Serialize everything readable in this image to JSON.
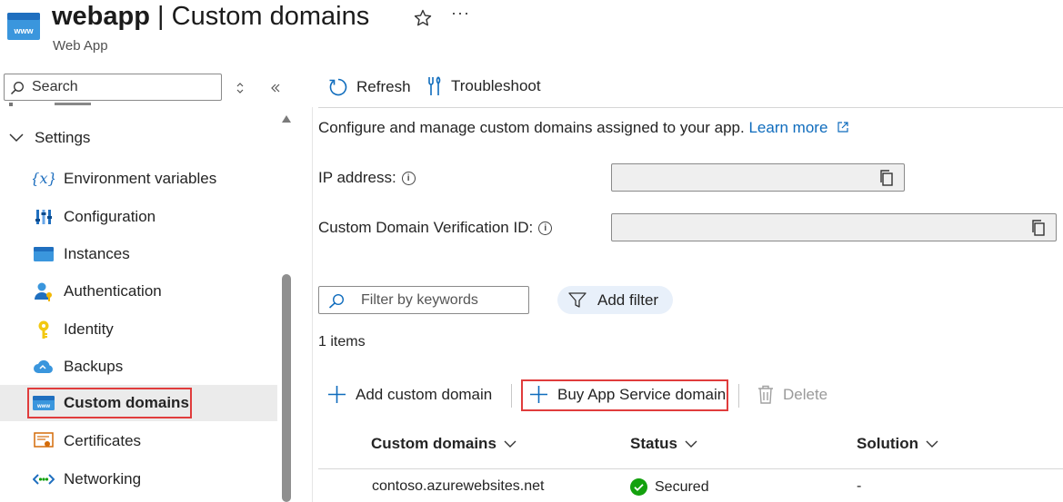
{
  "header": {
    "resource_name": "webapp",
    "separator": " | ",
    "page_name": "Custom domains",
    "subtitle": "Web App",
    "more_label": "···"
  },
  "sidebar": {
    "search_placeholder": "Search",
    "group_label": "Settings",
    "items": [
      {
        "label": "Environment variables",
        "icon": "environment-variables-icon"
      },
      {
        "label": "Configuration",
        "icon": "configuration-icon"
      },
      {
        "label": "Instances",
        "icon": "instances-icon"
      },
      {
        "label": "Authentication",
        "icon": "authentication-icon"
      },
      {
        "label": "Identity",
        "icon": "identity-icon"
      },
      {
        "label": "Backups",
        "icon": "backups-icon"
      },
      {
        "label": "Custom domains",
        "icon": "custom-domains-icon",
        "active": true
      },
      {
        "label": "Certificates",
        "icon": "certificates-icon"
      },
      {
        "label": "Networking",
        "icon": "networking-icon"
      }
    ]
  },
  "toolbar": {
    "refresh_label": "Refresh",
    "troubleshoot_label": "Troubleshoot"
  },
  "main": {
    "description": "Configure and manage custom domains assigned to your app.",
    "learn_more": "Learn more",
    "ip_address_label": "IP address:",
    "ip_address_value": "",
    "verification_id_label": "Custom Domain Verification ID:",
    "verification_id_value": "",
    "filter_placeholder": "Filter by keywords",
    "add_filter_label": "Add filter",
    "item_count": "1 items"
  },
  "actions": {
    "add_custom_domain": "Add custom domain",
    "buy_domain": "Buy App Service domain",
    "delete": "Delete"
  },
  "table": {
    "columns": [
      "Custom domains",
      "Status",
      "Solution"
    ],
    "rows": [
      {
        "domain": "contoso.azurewebsites.net",
        "status": "Secured",
        "solution": "-"
      }
    ]
  },
  "colors": {
    "link": "#0f6cbd",
    "highlight_outline": "#e03c3c",
    "secured_green": "#13a10e",
    "active_bg": "#ebebeb"
  }
}
